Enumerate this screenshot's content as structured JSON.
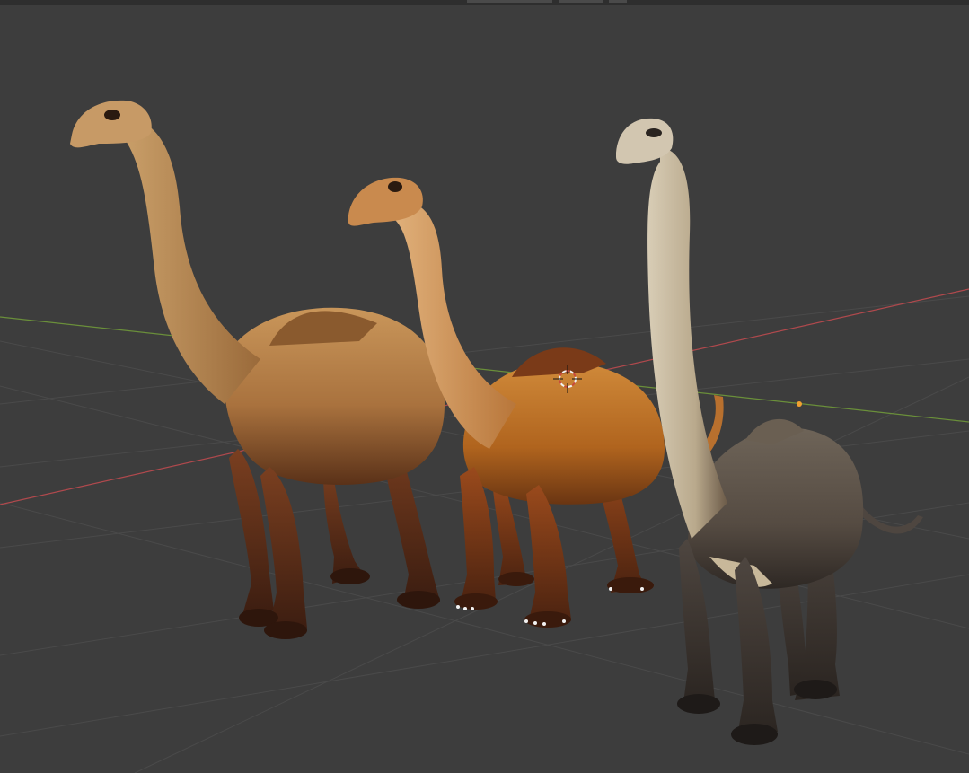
{
  "viewport": {
    "background": "#3d3d3d",
    "grid_color": "#484848",
    "x_axis_color": "#b0494d",
    "y_axis_color": "#6a8f3a",
    "cursor_colors": [
      "#c94a3c",
      "#f2f2f2"
    ],
    "origin_dot_color": "#f0a030"
  },
  "objects": [
    {
      "name": "dinosaur-tan",
      "body_color": "#c08a4e"
    },
    {
      "name": "dinosaur-orange",
      "body_color": "#c4782e"
    },
    {
      "name": "dinosaur-grey",
      "body_color": "#5e554c"
    }
  ],
  "icons": [
    "3d-cursor-icon",
    "origin-icon"
  ]
}
